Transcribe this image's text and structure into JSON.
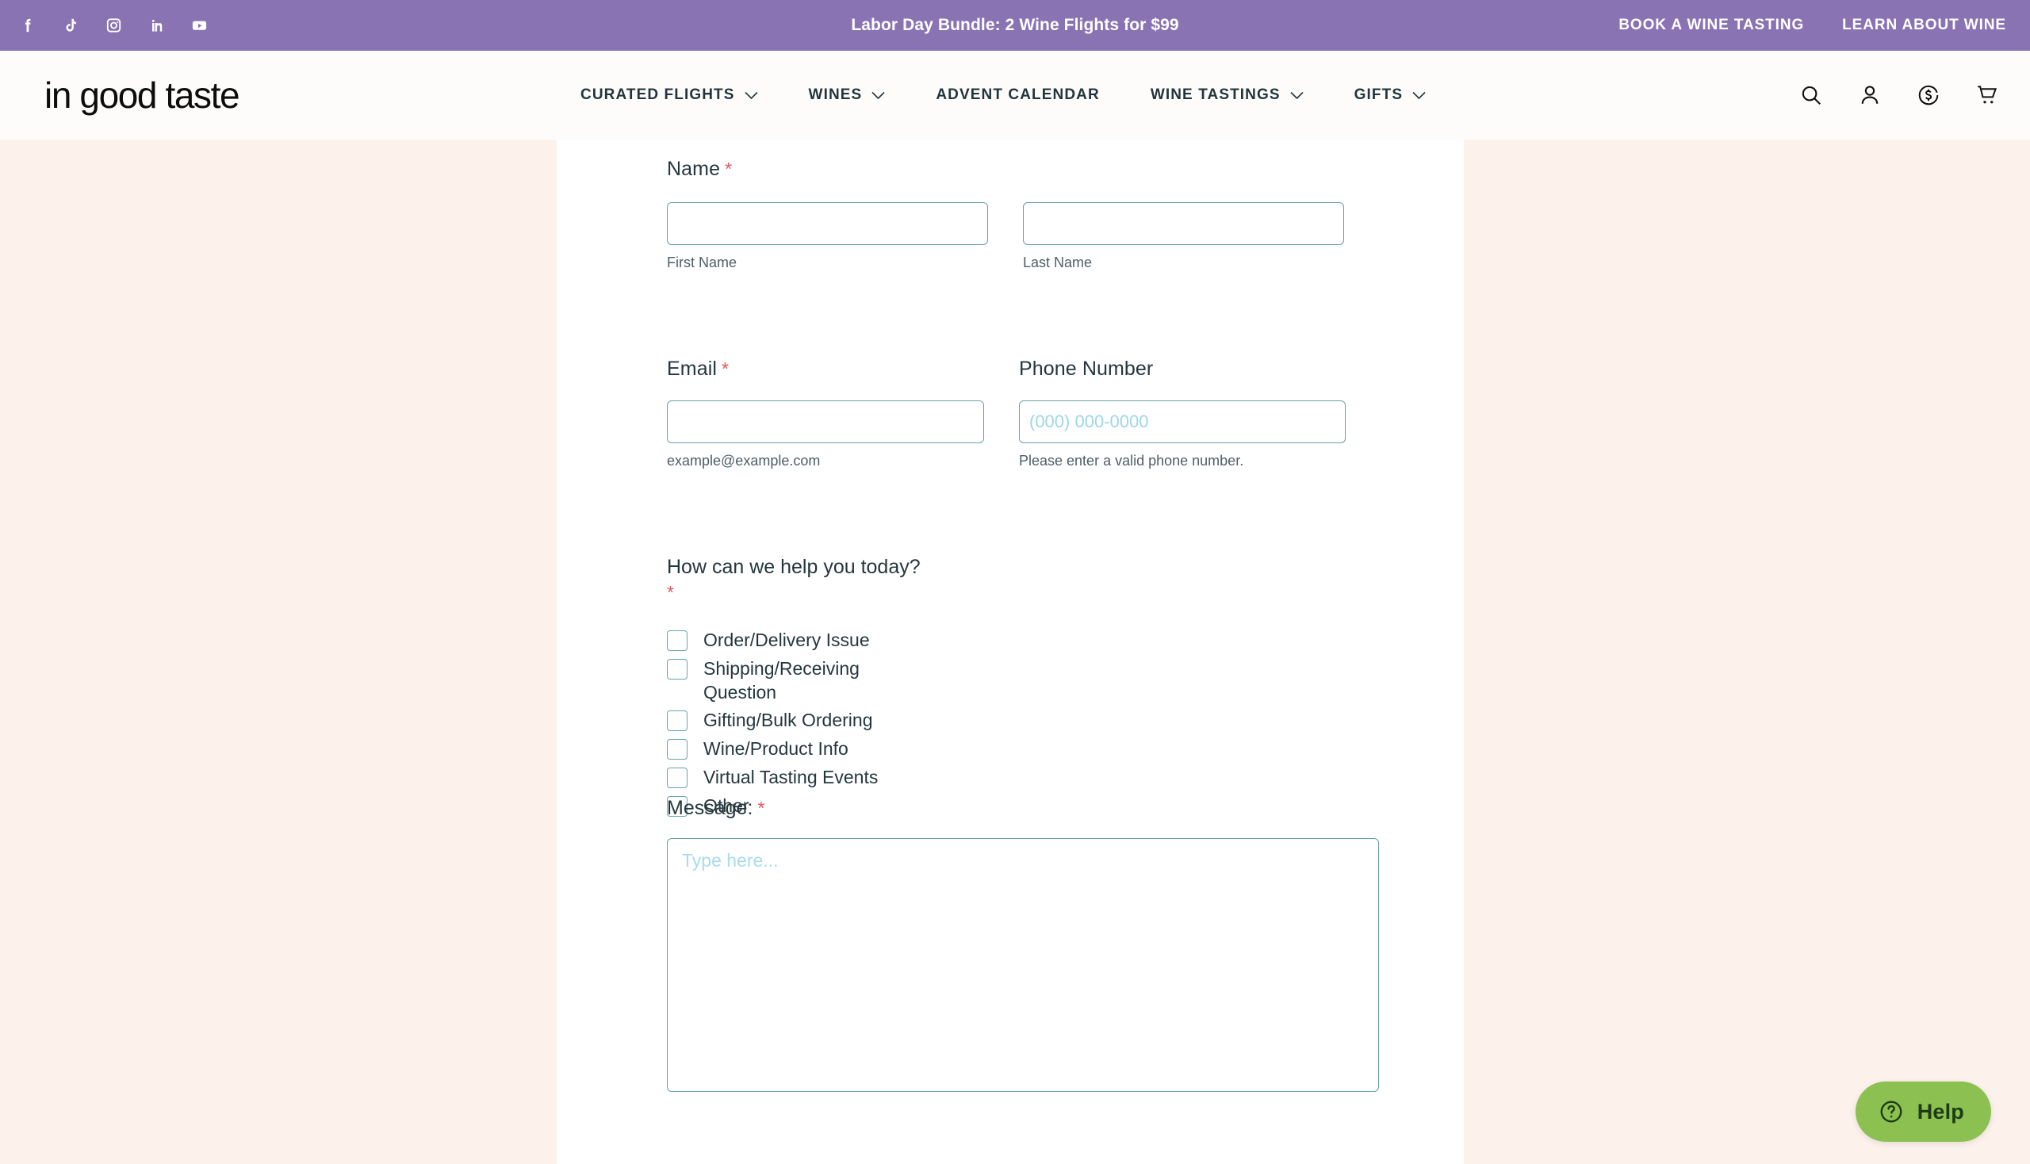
{
  "topbar": {
    "promo": "Labor Day Bundle: 2 Wine Flights for $99",
    "background_color": "#8a73b3",
    "social": [
      {
        "name": "facebook-icon",
        "label": "Facebook"
      },
      {
        "name": "tiktok-icon",
        "label": "TikTok"
      },
      {
        "name": "instagram-icon",
        "label": "Instagram"
      },
      {
        "name": "linkedin-icon",
        "label": "LinkedIn"
      },
      {
        "name": "youtube-icon",
        "label": "YouTube"
      }
    ],
    "links": [
      {
        "label": "BOOK A WINE TASTING"
      },
      {
        "label": "LEARN ABOUT WINE"
      }
    ]
  },
  "header": {
    "logo": "in good taste",
    "nav": [
      {
        "label": "CURATED FLIGHTS",
        "has_dropdown": true
      },
      {
        "label": "WINES",
        "has_dropdown": true
      },
      {
        "label": "ADVENT CALENDAR",
        "has_dropdown": false
      },
      {
        "label": "WINE TASTINGS",
        "has_dropdown": true
      },
      {
        "label": "GIFTS",
        "has_dropdown": true
      }
    ],
    "icons": [
      {
        "name": "search-icon"
      },
      {
        "name": "account-icon"
      },
      {
        "name": "rewards-dollar-icon"
      },
      {
        "name": "cart-icon"
      }
    ]
  },
  "form": {
    "name": {
      "label": "Name",
      "required_marker": "*",
      "first": {
        "value": "",
        "placeholder": "",
        "sublabel": "First Name"
      },
      "last": {
        "value": "",
        "placeholder": "",
        "sublabel": "Last Name"
      }
    },
    "email": {
      "label": "Email",
      "required_marker": "*",
      "value": "",
      "placeholder": "",
      "sublabel": "example@example.com"
    },
    "phone": {
      "label": "Phone Number",
      "value": "",
      "placeholder": "(000) 000-0000",
      "sublabel": "Please enter a valid phone number."
    },
    "help_topic": {
      "label": "How can we help you today?",
      "required_marker": "*",
      "options": [
        {
          "label": "Order/Delivery Issue",
          "checked": false
        },
        {
          "label": "Shipping/Receiving Question",
          "checked": false
        },
        {
          "label": "Gifting/Bulk Ordering",
          "checked": false
        },
        {
          "label": "Wine/Product Info",
          "checked": false
        },
        {
          "label": "Virtual Tasting Events",
          "checked": false
        },
        {
          "label": "Other",
          "checked": false
        }
      ]
    },
    "message": {
      "label": "Message:",
      "required_marker": "*",
      "value": "",
      "placeholder": "Type here..."
    }
  },
  "help_widget": {
    "label": "Help",
    "background_color": "#8cc152"
  },
  "colors": {
    "purple_bar": "#8a73b3",
    "page_cream": "#fdf1ec",
    "content_white": "#ffffff",
    "input_border": "#67a0a5",
    "text_dark": "#24373e",
    "required_red": "#e8545a",
    "placeholder_blue": "#9dd6e8",
    "help_green": "#8cc152"
  }
}
